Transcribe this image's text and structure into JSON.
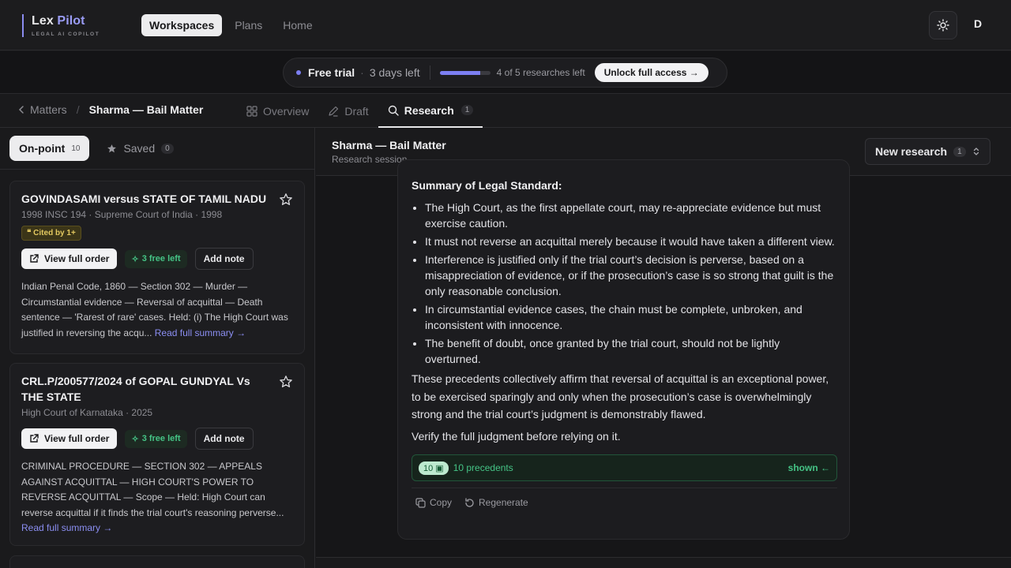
{
  "brand": {
    "name_part1": "Lex",
    "name_part2": "Pilot",
    "tagline": "LEGAL AI COPILOT"
  },
  "nav": {
    "items": [
      "Workspaces",
      "Plans",
      "Home"
    ],
    "active": "Workspaces"
  },
  "user": {
    "initial": "D"
  },
  "trial": {
    "label": "Free trial",
    "days_left": "3 days left",
    "researches_left": "4 of 5 researches left",
    "progress_fraction": 0.8,
    "unlock_label": "Unlock full access →"
  },
  "breadcrumb": {
    "parent": "Matters",
    "current": "Sharma — Bail Matter"
  },
  "tabs": [
    {
      "label": "Overview",
      "icon": "grid-icon"
    },
    {
      "label": "Draft",
      "icon": "pen-icon"
    },
    {
      "label": "Research",
      "icon": "search-icon",
      "count": "1"
    }
  ],
  "filters": {
    "onpoint_label": "On-point",
    "onpoint_count": "10",
    "saved_label": "Saved",
    "saved_count": "0"
  },
  "cards": [
    {
      "title": "GOVINDASAMI versus STATE OF TAMIL NADU",
      "meta": "1998 INSC 194 · Supreme Court of India · 1998",
      "cited": "Cited by 1+",
      "view_label": "View full order",
      "free_label": "3 free left",
      "note_label": "Add note",
      "summary": "Indian Penal Code, 1860 — Section 302 — Murder — Circumstantial evidence — Reversal of acquittal — Death sentence — 'Rarest of rare' cases. Held: (i) The High Court was justified in reversing the acqu...",
      "more_label": "Read full summary →"
    },
    {
      "title": "CRL.P/200577/2024 of GOPAL GUNDYAL Vs THE STATE",
      "meta": "High Court of Karnataka · 2025",
      "view_label": "View full order",
      "free_label": "3 free left",
      "note_label": "Add note",
      "summary": "CRIMINAL PROCEDURE — SECTION 302 — APPEALS AGAINST ACQUITTAL — HIGH COURT'S POWER TO REVERSE ACQUITTAL — Scope — Held: High Court can reverse acquittal if it finds the trial court's reasoning perverse...",
      "more_label": "Read full summary →"
    }
  ],
  "session": {
    "title": "Sharma — Bail Matter",
    "subtitle": "Research session",
    "new_research_label": "New research",
    "new_research_count": "1"
  },
  "answer": {
    "heading": "Summary of Legal Standard:",
    "bullets": [
      "The High Court, as the first appellate court, may re-appreciate evidence but must exercise caution.",
      "It must not reverse an acquittal merely because it would have taken a different view.",
      "Interference is justified only if the trial court’s decision is perverse, based on a misappreciation of evidence, or if the prosecution’s case is so strong that guilt is the only reasonable conclusion.",
      "In circumstantial evidence cases, the chain must be complete, unbroken, and inconsistent with innocence.",
      "The benefit of doubt, once granted by the trial court, should not be lightly overturned."
    ],
    "body": "These precedents collectively affirm that reversal of acquittal is an exceptional power, to be exercised sparingly and only when the prosecution’s case is overwhelmingly strong and the trial court’s judgment is demonstrably flawed.",
    "verify": "Verify the full judgment before relying on it.",
    "precedents_badge": "10",
    "precedents_label": "10 precedents",
    "shown_label": "shown ←",
    "copy_label": "Copy",
    "regenerate_label": "Regenerate"
  }
}
